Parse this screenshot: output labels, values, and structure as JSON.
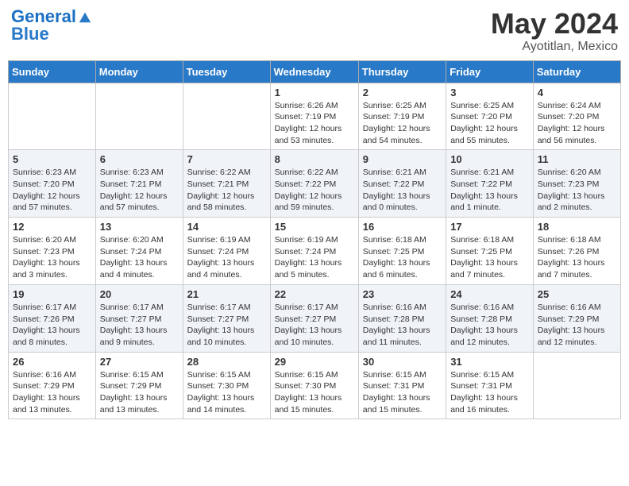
{
  "header": {
    "logo_general": "General",
    "logo_blue": "Blue",
    "month_year": "May 2024",
    "location": "Ayotitlan, Mexico"
  },
  "days_of_week": [
    "Sunday",
    "Monday",
    "Tuesday",
    "Wednesday",
    "Thursday",
    "Friday",
    "Saturday"
  ],
  "weeks": [
    [
      {
        "day": "",
        "info": ""
      },
      {
        "day": "",
        "info": ""
      },
      {
        "day": "",
        "info": ""
      },
      {
        "day": "1",
        "info": "Sunrise: 6:26 AM\nSunset: 7:19 PM\nDaylight: 12 hours\nand 53 minutes."
      },
      {
        "day": "2",
        "info": "Sunrise: 6:25 AM\nSunset: 7:19 PM\nDaylight: 12 hours\nand 54 minutes."
      },
      {
        "day": "3",
        "info": "Sunrise: 6:25 AM\nSunset: 7:20 PM\nDaylight: 12 hours\nand 55 minutes."
      },
      {
        "day": "4",
        "info": "Sunrise: 6:24 AM\nSunset: 7:20 PM\nDaylight: 12 hours\nand 56 minutes."
      }
    ],
    [
      {
        "day": "5",
        "info": "Sunrise: 6:23 AM\nSunset: 7:20 PM\nDaylight: 12 hours\nand 57 minutes."
      },
      {
        "day": "6",
        "info": "Sunrise: 6:23 AM\nSunset: 7:21 PM\nDaylight: 12 hours\nand 57 minutes."
      },
      {
        "day": "7",
        "info": "Sunrise: 6:22 AM\nSunset: 7:21 PM\nDaylight: 12 hours\nand 58 minutes."
      },
      {
        "day": "8",
        "info": "Sunrise: 6:22 AM\nSunset: 7:22 PM\nDaylight: 12 hours\nand 59 minutes."
      },
      {
        "day": "9",
        "info": "Sunrise: 6:21 AM\nSunset: 7:22 PM\nDaylight: 13 hours\nand 0 minutes."
      },
      {
        "day": "10",
        "info": "Sunrise: 6:21 AM\nSunset: 7:22 PM\nDaylight: 13 hours\nand 1 minute."
      },
      {
        "day": "11",
        "info": "Sunrise: 6:20 AM\nSunset: 7:23 PM\nDaylight: 13 hours\nand 2 minutes."
      }
    ],
    [
      {
        "day": "12",
        "info": "Sunrise: 6:20 AM\nSunset: 7:23 PM\nDaylight: 13 hours\nand 3 minutes."
      },
      {
        "day": "13",
        "info": "Sunrise: 6:20 AM\nSunset: 7:24 PM\nDaylight: 13 hours\nand 4 minutes."
      },
      {
        "day": "14",
        "info": "Sunrise: 6:19 AM\nSunset: 7:24 PM\nDaylight: 13 hours\nand 4 minutes."
      },
      {
        "day": "15",
        "info": "Sunrise: 6:19 AM\nSunset: 7:24 PM\nDaylight: 13 hours\nand 5 minutes."
      },
      {
        "day": "16",
        "info": "Sunrise: 6:18 AM\nSunset: 7:25 PM\nDaylight: 13 hours\nand 6 minutes."
      },
      {
        "day": "17",
        "info": "Sunrise: 6:18 AM\nSunset: 7:25 PM\nDaylight: 13 hours\nand 7 minutes."
      },
      {
        "day": "18",
        "info": "Sunrise: 6:18 AM\nSunset: 7:26 PM\nDaylight: 13 hours\nand 7 minutes."
      }
    ],
    [
      {
        "day": "19",
        "info": "Sunrise: 6:17 AM\nSunset: 7:26 PM\nDaylight: 13 hours\nand 8 minutes."
      },
      {
        "day": "20",
        "info": "Sunrise: 6:17 AM\nSunset: 7:27 PM\nDaylight: 13 hours\nand 9 minutes."
      },
      {
        "day": "21",
        "info": "Sunrise: 6:17 AM\nSunset: 7:27 PM\nDaylight: 13 hours\nand 10 minutes."
      },
      {
        "day": "22",
        "info": "Sunrise: 6:17 AM\nSunset: 7:27 PM\nDaylight: 13 hours\nand 10 minutes."
      },
      {
        "day": "23",
        "info": "Sunrise: 6:16 AM\nSunset: 7:28 PM\nDaylight: 13 hours\nand 11 minutes."
      },
      {
        "day": "24",
        "info": "Sunrise: 6:16 AM\nSunset: 7:28 PM\nDaylight: 13 hours\nand 12 minutes."
      },
      {
        "day": "25",
        "info": "Sunrise: 6:16 AM\nSunset: 7:29 PM\nDaylight: 13 hours\nand 12 minutes."
      }
    ],
    [
      {
        "day": "26",
        "info": "Sunrise: 6:16 AM\nSunset: 7:29 PM\nDaylight: 13 hours\nand 13 minutes."
      },
      {
        "day": "27",
        "info": "Sunrise: 6:15 AM\nSunset: 7:29 PM\nDaylight: 13 hours\nand 13 minutes."
      },
      {
        "day": "28",
        "info": "Sunrise: 6:15 AM\nSunset: 7:30 PM\nDaylight: 13 hours\nand 14 minutes."
      },
      {
        "day": "29",
        "info": "Sunrise: 6:15 AM\nSunset: 7:30 PM\nDaylight: 13 hours\nand 15 minutes."
      },
      {
        "day": "30",
        "info": "Sunrise: 6:15 AM\nSunset: 7:31 PM\nDaylight: 13 hours\nand 15 minutes."
      },
      {
        "day": "31",
        "info": "Sunrise: 6:15 AM\nSunset: 7:31 PM\nDaylight: 13 hours\nand 16 minutes."
      },
      {
        "day": "",
        "info": ""
      }
    ]
  ]
}
